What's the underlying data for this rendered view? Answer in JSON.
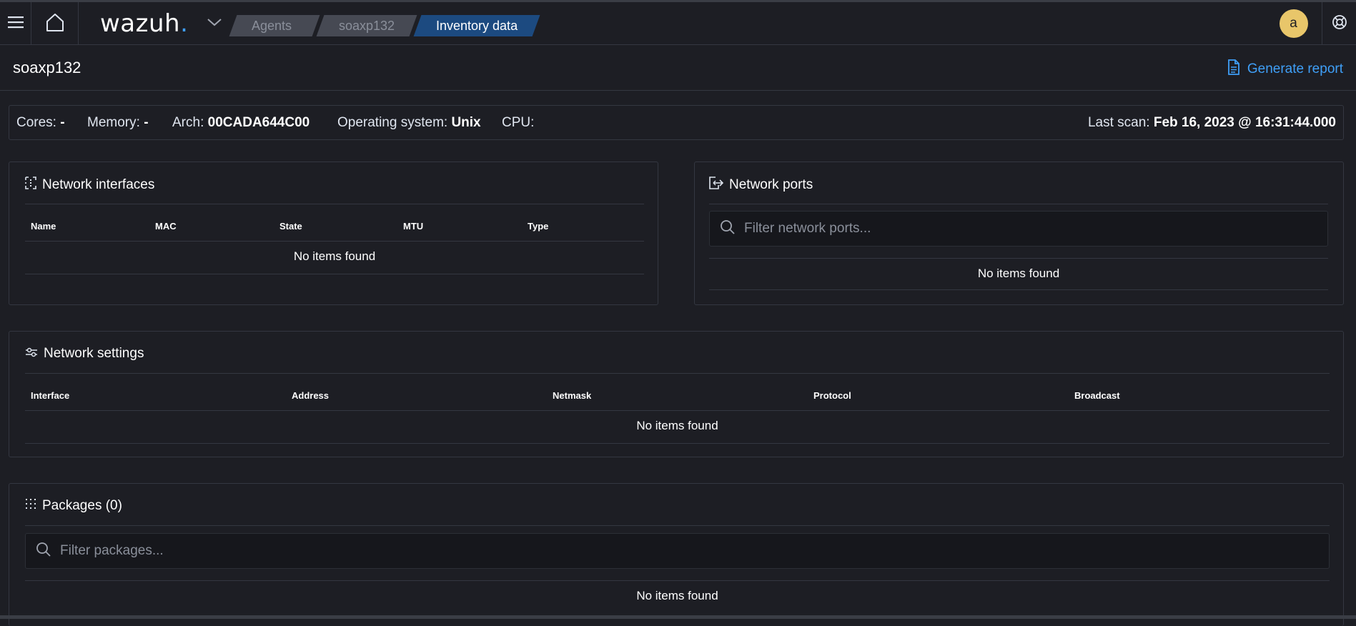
{
  "header": {
    "logo": "wazuh",
    "logo_dot": ".",
    "breadcrumbs": [
      "Agents",
      "soaxp132",
      "Inventory data"
    ],
    "avatar_letter": "a"
  },
  "page": {
    "title": "soaxp132",
    "generate_report": "Generate report"
  },
  "info": {
    "cores_label": "Cores:",
    "cores_value": "-",
    "memory_label": "Memory:",
    "memory_value": "-",
    "arch_label": "Arch:",
    "arch_value": "00CADA644C00",
    "os_label": "Operating system:",
    "os_value": "Unix",
    "cpu_label": "CPU:",
    "cpu_value": "",
    "last_scan_label": "Last scan:",
    "last_scan_value": "Feb 16, 2023 @ 16:31:44.000"
  },
  "network_interfaces": {
    "title": "Network interfaces",
    "columns": [
      "Name",
      "MAC",
      "State",
      "MTU",
      "Type"
    ],
    "empty": "No items found"
  },
  "network_ports": {
    "title": "Network ports",
    "search_placeholder": "Filter network ports...",
    "empty": "No items found"
  },
  "network_settings": {
    "title": "Network settings",
    "columns": [
      "Interface",
      "Address",
      "Netmask",
      "Protocol",
      "Broadcast"
    ],
    "empty": "No items found"
  },
  "packages": {
    "title": "Packages (0)",
    "search_placeholder": "Filter packages...",
    "empty": "No items found"
  },
  "colors": {
    "background": "#1d1e24",
    "accent": "#3f9ff7",
    "breadcrumb_active": "#1c4a80",
    "avatar": "#e8c66a"
  }
}
